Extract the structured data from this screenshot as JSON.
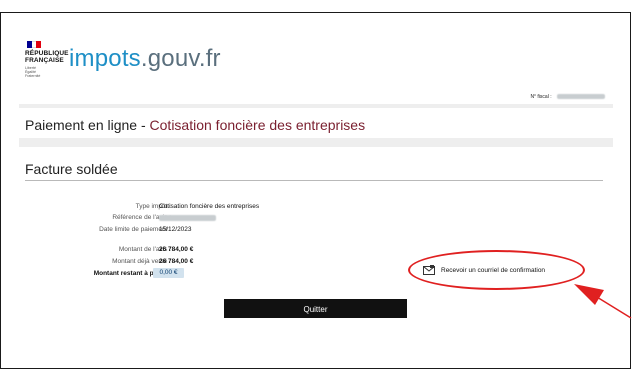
{
  "colors": {
    "brand_blue": "#1e8fc6",
    "tax_name": "#7a1f2f",
    "annotation_red": "#e02020",
    "button_bg": "#111111",
    "badge_bg": "#d2e2ee",
    "flag": [
      "#000091",
      "#ffffff",
      "#e1000f"
    ]
  },
  "header": {
    "republique_line1": "RÉPUBLIQUE",
    "republique_line2": "FRANÇAISE",
    "devise": [
      "Liberté",
      "Égalité",
      "Fraternité"
    ],
    "logo_impots": "impots",
    "logo_gouv": ".gouv.fr",
    "fiscal_label": "N° fiscal :"
  },
  "payment_panel": {
    "prefix": "Paiement en ligne - ",
    "tax_name": "Cotisation foncière des entreprises"
  },
  "invoice": {
    "title": "Facture soldée",
    "type_label": "Type impôt :",
    "type_value": "Cotisation foncière des entreprises",
    "reference_label": "Référence de l'avis :",
    "due_label": "Date limite de paiement :",
    "due_value": "15/12/2023",
    "amount_label": "Montant de l'avis :",
    "amount_value": "26 784,00 €",
    "paid_label": "Montant déjà versé :",
    "paid_value": "26 784,00 €",
    "remaining_label": "Montant restant à payer :",
    "remaining_value": "0,00 €"
  },
  "actions": {
    "confirm_icon": "envelope-icon",
    "confirm_label": "Recevoir un courriel de confirmation",
    "quit_label": "Quitter"
  }
}
